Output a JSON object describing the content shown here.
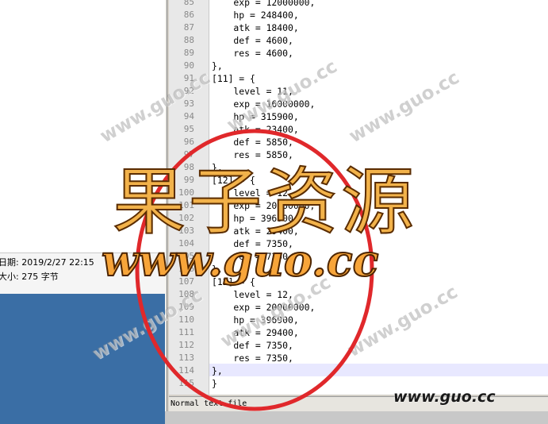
{
  "file_info": {
    "date_line": "日期: 2019/2/27 22:15",
    "size_line": "大小: 275 字节"
  },
  "editor": {
    "lines": [
      {
        "num": "85",
        "code": "    exp = 12000000,"
      },
      {
        "num": "86",
        "code": "    hp = 248400,"
      },
      {
        "num": "87",
        "code": "    atk = 18400,"
      },
      {
        "num": "88",
        "code": "    def = 4600,"
      },
      {
        "num": "89",
        "code": "    res = 4600,"
      },
      {
        "num": "90",
        "code": "},"
      },
      {
        "num": "91",
        "code": "[11] = {"
      },
      {
        "num": "92",
        "code": "    level = 11,"
      },
      {
        "num": "93",
        "code": "    exp = 16000000,"
      },
      {
        "num": "94",
        "code": "    hp = 315900,"
      },
      {
        "num": "95",
        "code": "    atk = 23400,"
      },
      {
        "num": "96",
        "code": "    def = 5850,"
      },
      {
        "num": "97",
        "code": "    res = 5850,"
      },
      {
        "num": "98",
        "code": "},"
      },
      {
        "num": "99",
        "code": "[12] = {"
      },
      {
        "num": "100",
        "code": "    level = 12,"
      },
      {
        "num": "101",
        "code": "    exp = 20000000,"
      },
      {
        "num": "102",
        "code": "    hp = 396900,"
      },
      {
        "num": "103",
        "code": "    atk = 29400,"
      },
      {
        "num": "104",
        "code": "    def = 7350,"
      },
      {
        "num": "105",
        "code": "    res = 7350,"
      },
      {
        "num": "106",
        "code": "},"
      },
      {
        "num": "107",
        "code": "[12] = {"
      },
      {
        "num": "108",
        "code": "    level = 12,"
      },
      {
        "num": "109",
        "code": "    exp = 20000000,"
      },
      {
        "num": "110",
        "code": "    hp = 396900,"
      },
      {
        "num": "111",
        "code": "    atk = 29400,"
      },
      {
        "num": "112",
        "code": "    def = 7350,"
      },
      {
        "num": "113",
        "code": "    res = 7350,"
      },
      {
        "num": "114",
        "code": "},"
      },
      {
        "num": "115",
        "code": "}"
      }
    ],
    "current_line": "114"
  },
  "status_bar": {
    "text": "Normal text file"
  },
  "watermark": {
    "brand": "果子资源",
    "url": "www.guo.cc",
    "tile_text": "www.guo.cc",
    "corner_url": "www.guo.cc"
  },
  "colors": {
    "desktop_blue": "#3a6ea5",
    "brand_orange": "#f2b24a",
    "circle_red": "#e0282b",
    "current_line_bg": "#e8e8ff"
  }
}
